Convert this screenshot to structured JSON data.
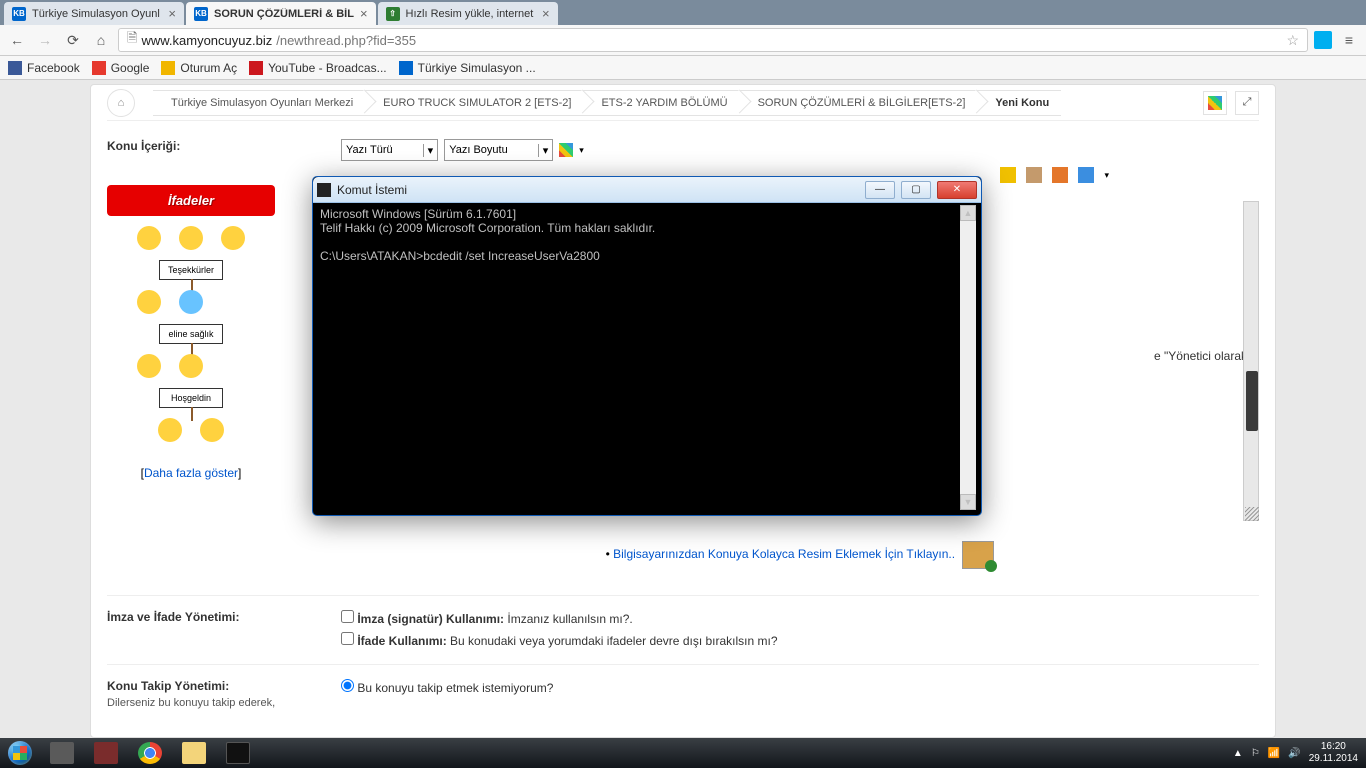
{
  "window_controls": {
    "min": "—",
    "max": "▭",
    "close": "✕"
  },
  "tabs": [
    {
      "title": "Türkiye Simulasyon Oyunl",
      "fav": "KB"
    },
    {
      "title": "SORUN ÇÖZÜMLERİ & BİL",
      "fav": "KB",
      "active": true
    },
    {
      "title": "Hızlı Resim yükle, internet",
      "fav": "HR"
    }
  ],
  "address": {
    "scheme_icon": "🗎",
    "host": "www.kamyoncuyuz.biz",
    "path": "/newthread.php?fid=355"
  },
  "bookmarks": [
    {
      "label": "Facebook",
      "cls": "fb"
    },
    {
      "label": "Google",
      "cls": "gg"
    },
    {
      "label": "Oturum Aç",
      "cls": "ch"
    },
    {
      "label": "YouTube - Broadcas...",
      "cls": "yt"
    },
    {
      "label": "Türkiye Simulasyon ...",
      "cls": "kb"
    }
  ],
  "breadcrumbs": [
    "Türkiye Simulasyon Oyunları Merkezi",
    "EURO TRUCK SIMULATOR 2 [ETS-2]",
    "ETS-2 YARDIM BÖLÜMÜ",
    "SORUN ÇÖZÜMLERİ & BİLGİLER[ETS-2]",
    "Yeni Konu"
  ],
  "content_label": "Konu İçeriği:",
  "font_select": "Yazı Türü",
  "size_select": "Yazı Boyutu",
  "smileys": {
    "header": "İfadeler",
    "sign1": "Teşekkürler",
    "sign2": "eline sağlık",
    "sign3": "Hoşgeldin",
    "more_l": "[",
    "more": "Daha fazla göster",
    "more_r": "]"
  },
  "editor_peek": "e \"Yönetici olarak",
  "attach": {
    "bullet": "•",
    "text": "Bilgisayarınızdan Konuya Kolayca Resim Eklemek İçin Tıklayın.."
  },
  "sig_section": {
    "label": "İmza ve İfade Yönetimi:",
    "opt1_b": "İmza (signatür) Kullanımı:",
    "opt1_t": " İmzanız kullanılsın mı?.",
    "opt2_b": "İfade Kullanımı:",
    "opt2_t": " Bu konudaki veya yorumdaki ifadeler devre dışı bırakılsın mı?"
  },
  "follow_section": {
    "label": "Konu Takip Yönetimi:",
    "sub": "Dilerseniz bu konuyu takip ederek,",
    "opt": "Bu konuyu takip etmek istemiyorum?"
  },
  "cmd": {
    "title": "Komut İstemi",
    "lines": "Microsoft Windows [Sürüm 6.1.7601]\nTelif Hakkı (c) 2009 Microsoft Corporation. Tüm hakları saklıdır.\n\nC:\\Users\\ATAKAN>bcdedit /set IncreaseUserVa2800"
  },
  "tray": {
    "up": "▲",
    "flag": "⚐",
    "net": "📶",
    "vol": "🔊",
    "time": "16:20",
    "date": "29.11.2014"
  }
}
